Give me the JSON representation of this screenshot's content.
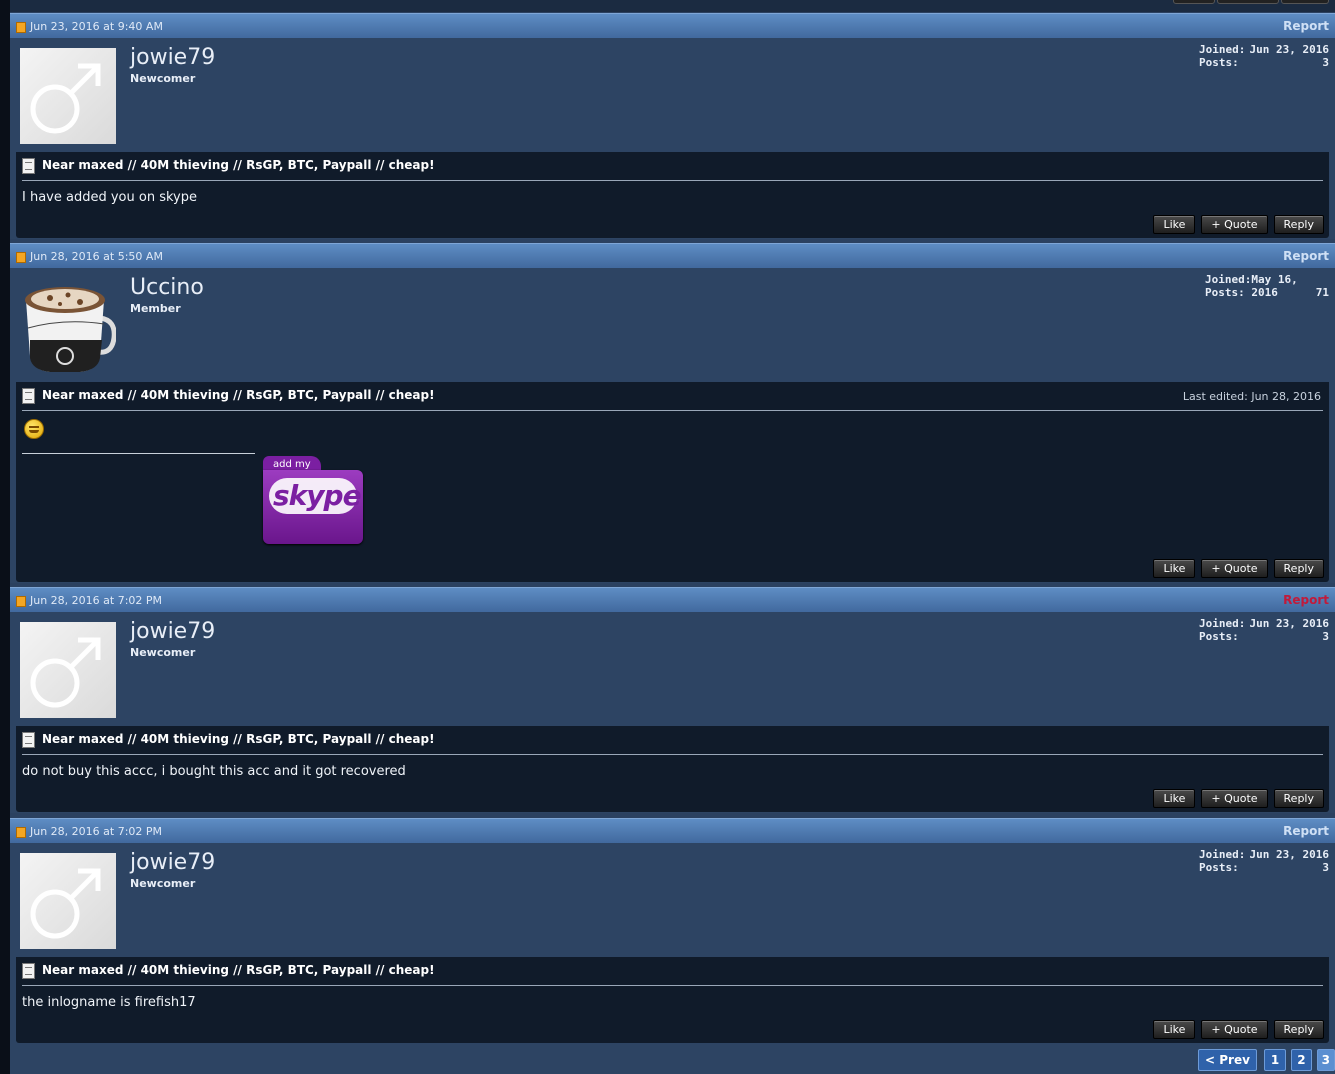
{
  "thread_title": "Near maxed // 40M thieving // RsGP, BTC, Paypall // cheap!",
  "labels": {
    "report": "Report",
    "joined": "Joined:",
    "posts": "Posts:",
    "like": "Like",
    "quote": "+ Quote",
    "reply": "Reply"
  },
  "posts": [
    {
      "date": "Jun 23, 2016 at 9:40 AM",
      "username": "jowie79",
      "role": "Newcomer",
      "joined": "Jun 23, 2016",
      "post_count": "3",
      "message": "I have added you on skype"
    },
    {
      "date": "Jun 28, 2016 at 5:50 AM",
      "username": "Uccino",
      "role": "Member",
      "joined": "May 16, 2016",
      "post_count": "71",
      "last_edited": "Last edited: Jun 28, 2016",
      "signature_badge": {
        "top": "add my",
        "main": "skype"
      }
    },
    {
      "date": "Jun 28, 2016 at 7:02 PM",
      "username": "jowie79",
      "role": "Newcomer",
      "joined": "Jun 23, 2016",
      "post_count": "3",
      "message": "do not buy this accc, i bought this acc and it got recovered",
      "report_color": "#c21a3a"
    },
    {
      "date": "Jun 28, 2016 at 7:02 PM",
      "username": "jowie79",
      "role": "Newcomer",
      "joined": "Jun 23, 2016",
      "post_count": "3",
      "message": "the inlogname is firefish17"
    }
  ],
  "pagination": {
    "prev": "< Prev",
    "pages": [
      "1",
      "2",
      "3"
    ],
    "current": "3"
  },
  "colors": {
    "header_blue": "#4f7bb3",
    "body_blue": "#2d4463",
    "content_dark": "#101b2a",
    "skype_purple": "#7b1fa2"
  }
}
